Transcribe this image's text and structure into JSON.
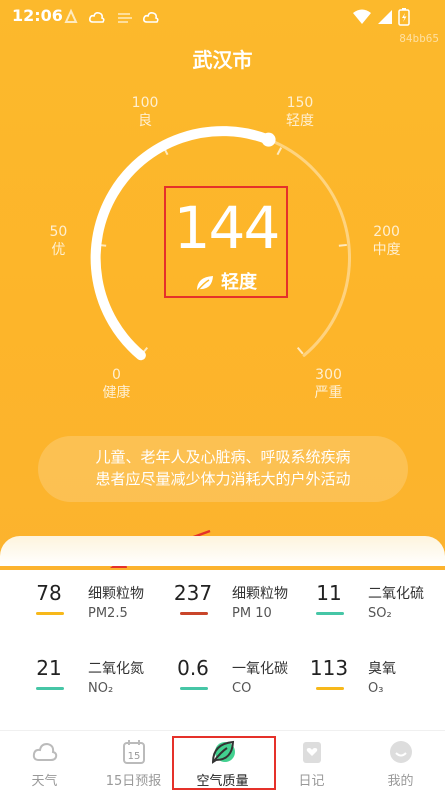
{
  "status_bar": {
    "time": "12:06"
  },
  "watermark": "84bb65",
  "city": "武汉市",
  "gauge": {
    "value": 144,
    "level": "轻度",
    "max": 300,
    "ticks": [
      {
        "value": "0",
        "label": "健康"
      },
      {
        "value": "50",
        "label": "优"
      },
      {
        "value": "100",
        "label": "良"
      },
      {
        "value": "150",
        "label": "轻度"
      },
      {
        "value": "200",
        "label": "中度"
      },
      {
        "value": "300",
        "label": "严重"
      }
    ]
  },
  "advice": {
    "line1": "儿童、老年人及心脏病、呼吸系统疾病",
    "line2": "患者应尽量减少体力消耗大的户外活动"
  },
  "pollutants": [
    {
      "value": "78",
      "name": "细颗粒物",
      "code": "PM2.5",
      "color": "#f7b81a"
    },
    {
      "value": "237",
      "name": "细颗粒物",
      "code": "PM 10",
      "color": "#c9452a"
    },
    {
      "value": "11",
      "name": "二氧化硫",
      "code": "SO₂",
      "color": "#46c6a6"
    },
    {
      "value": "21",
      "name": "二氧化氮",
      "code": "NO₂",
      "color": "#46c6a6"
    },
    {
      "value": "0.6",
      "name": "一氧化碳",
      "code": "CO",
      "color": "#46c6a6"
    },
    {
      "value": "113",
      "name": "臭氧",
      "code": "O₃",
      "color": "#f7b81a"
    }
  ],
  "tabs": [
    {
      "label": "天气",
      "icon": "cloud-icon"
    },
    {
      "label": "15日预报",
      "icon": "calendar-icon",
      "badge": "15"
    },
    {
      "label": "空气质量",
      "icon": "leaf-icon",
      "active": true
    },
    {
      "label": "日记",
      "icon": "diary-icon"
    },
    {
      "label": "我的",
      "icon": "profile-icon"
    }
  ],
  "colors": {
    "brand": "#fcb92c",
    "annotation": "#e5312a",
    "leaf": "#2ecc71"
  }
}
